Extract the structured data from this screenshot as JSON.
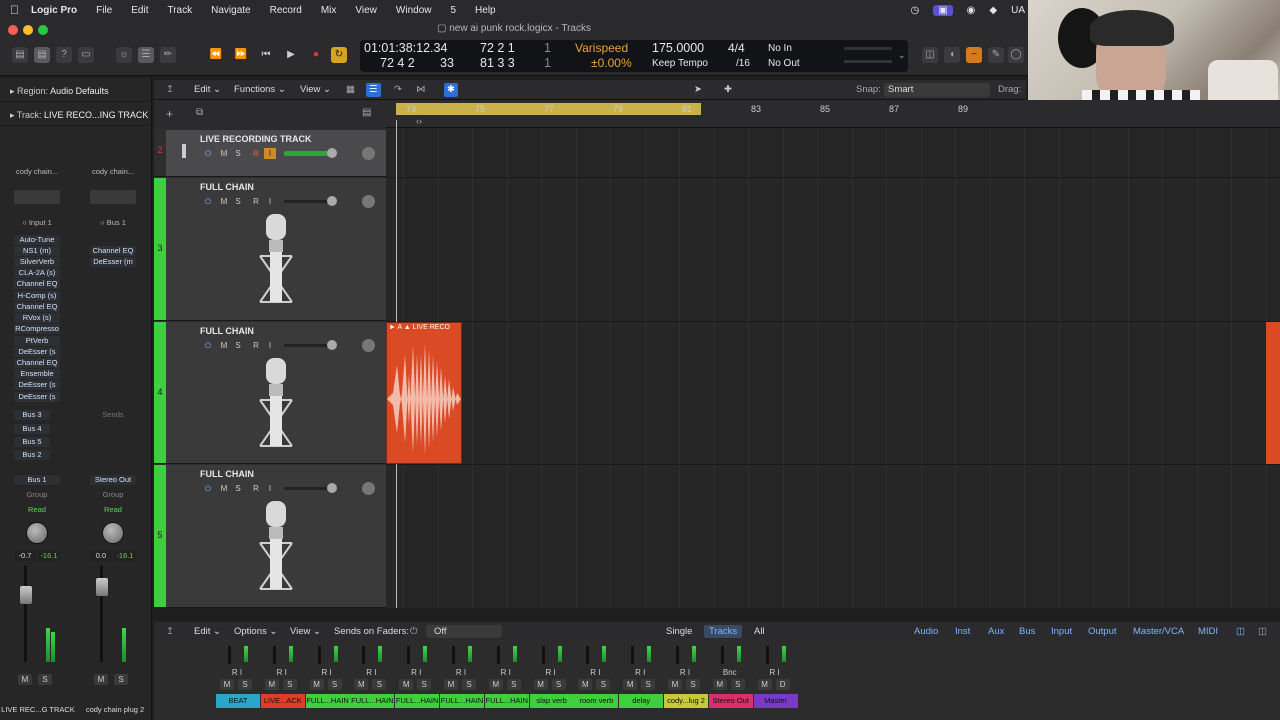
{
  "menubar": {
    "apple": "",
    "app": "Logic Pro",
    "items": [
      "File",
      "Edit",
      "Track",
      "Navigate",
      "Record",
      "Mix",
      "View",
      "Window",
      "5",
      "Help"
    ],
    "status_right": "UA"
  },
  "window": {
    "title": "new ai punk rock.logicx - Tracks"
  },
  "lcd": {
    "position": "01:01:38:12.34",
    "bars_top": "72  2  1",
    "bars_top_tick": "1",
    "bars_bottom": "72  4  2",
    "bars_bottom_tick": "33",
    "bars2_top": "72  2  1",
    "bars2_top_tick": "1",
    "bars2_bottom": "81  3  3",
    "bars2_bottom_tick": "1",
    "varispeed_label": "Varispeed",
    "varispeed_value": "±0.00%",
    "tempo": "175.0000",
    "tempo_mode": "Keep Tempo",
    "time_sig": "4/4",
    "division": "/16",
    "in": "No In",
    "out": "No Out"
  },
  "inspector": {
    "region": "Region:",
    "region_value": "Audio Defaults",
    "track": "Track:",
    "track_value": "LIVE RECO...ING TRACK",
    "strip1": {
      "setting": "cody chain...",
      "input": "Input 1",
      "plugins": [
        "Auto-Tune",
        "NS1 (m)",
        "SilverVerb",
        "CLA-2A (s)",
        "Channel EQ",
        "H-Comp (s)",
        "Channel EQ",
        "RVox (s)",
        "RCompresso",
        "PtVerb",
        "DeEsser (s",
        "Channel EQ",
        "Ensemble",
        "DeEsser (s",
        "DeEsser (s"
      ],
      "sends": [
        "Bus 3",
        "Bus 4",
        "Bus 5",
        "Bus 2"
      ],
      "output": "Bus 1",
      "group": "Group",
      "automation": "Read",
      "vol": "-0.7",
      "peak": "-16.1",
      "m": "M",
      "s": "S",
      "name": "LIVE REC...G TRACK"
    },
    "strip2": {
      "setting": "cody chain...",
      "input": "Bus 1",
      "plugins": [
        "Channel EQ",
        "DeEsser (m"
      ],
      "sends_label": "Sends",
      "output": "Stereo Out",
      "group": "Group",
      "automation": "Read",
      "vol": "0.0",
      "peak": "-16.1",
      "m": "M",
      "s": "S",
      "name": "cody chain plug 2"
    }
  },
  "tracks_header": {
    "edit": "Edit",
    "functions": "Functions",
    "view": "View",
    "snap_label": "Snap:",
    "snap_value": "Smart",
    "drag_label": "Drag:"
  },
  "tracks": [
    {
      "num": "2",
      "name": "LIVE RECORDING TRACK",
      "m": "M",
      "s": "S",
      "r": "R",
      "i": "I"
    },
    {
      "num": "3",
      "name": "FULL CHAIN",
      "m": "M",
      "s": "S",
      "r": "R",
      "i": "I"
    },
    {
      "num": "4",
      "name": "FULL CHAIN",
      "m": "M",
      "s": "S",
      "r": "R",
      "i": "I"
    },
    {
      "num": "5",
      "name": "FULL CHAIN",
      "m": "M",
      "s": "S",
      "r": "R",
      "i": "I"
    }
  ],
  "ruler": {
    "bars": [
      "73",
      "75",
      "77",
      "79",
      "81",
      "83",
      "85",
      "87",
      "89"
    ]
  },
  "region": {
    "label": "LIVE RECO",
    "color": "#d94a25"
  },
  "mixer_header": {
    "edit": "Edit",
    "options": "Options",
    "view": "View",
    "sends_on_faders": "Sends on Faders:",
    "sends_value": "Off",
    "single": "Single",
    "tracks": "Tracks",
    "all": "All",
    "filters": [
      "Audio",
      "Inst",
      "Aux",
      "Bus",
      "Input",
      "Output",
      "Master/VCA",
      "MIDI"
    ]
  },
  "mixer": {
    "strips": [
      {
        "name": "BEAT",
        "color": "#2aa6c8"
      },
      {
        "name": "LIVE...ACK",
        "color": "#e23b2a"
      },
      {
        "name": "FULL...HAIN",
        "color": "#3ecf3e"
      },
      {
        "name": "FULL...HAIN",
        "color": "#3ecf3e"
      },
      {
        "name": "FULL...HAIN",
        "color": "#3ecf3e"
      },
      {
        "name": "FULL...HAIN",
        "color": "#3ecf3e"
      },
      {
        "name": "FULL...HAIN",
        "color": "#3ecf3e"
      },
      {
        "name": "slap verb",
        "color": "#3ecf3e"
      },
      {
        "name": "room verb",
        "color": "#3ecf3e"
      },
      {
        "name": "delay",
        "color": "#3ecf3e"
      },
      {
        "name": "cody...lug 2",
        "color": "#c8c83a"
      },
      {
        "name": "Stereo Out",
        "color": "#d8306a"
      },
      {
        "name": "Master",
        "color": "#7a3ac8"
      }
    ],
    "m": "M",
    "s": "S",
    "ri": "R I",
    "bnc": "Bnc",
    "d": "D"
  }
}
